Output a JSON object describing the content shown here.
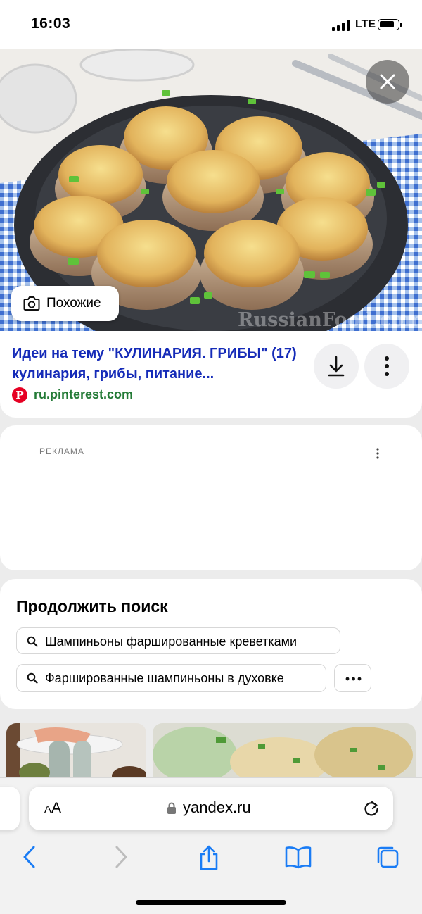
{
  "status_bar": {
    "time": "16:03",
    "network": "LTE"
  },
  "image_viewer": {
    "similar_label": "Похожие",
    "watermark": "RussianFood.com"
  },
  "result": {
    "title": "Идеи на тему \"КУЛИНАРИЯ. ГРИБЫ\" (17) кулинария, грибы, питание...",
    "source": "ru.pinterest.com",
    "source_logo_letter": "P"
  },
  "ad": {
    "label": "РЕКЛАМА"
  },
  "continue_search": {
    "title": "Продолжить поиск",
    "chips": [
      "Шампиньоны фаршированные креветками",
      "Фаршированные шампиньоны в духовке"
    ]
  },
  "browser": {
    "text_size_small": "A",
    "text_size_large": "A",
    "url": "yandex.ru"
  },
  "colors": {
    "title_link": "#152bb8",
    "source_link": "#237a36",
    "pinterest_red": "#e60023",
    "accent_blue": "#1a7cf5"
  }
}
